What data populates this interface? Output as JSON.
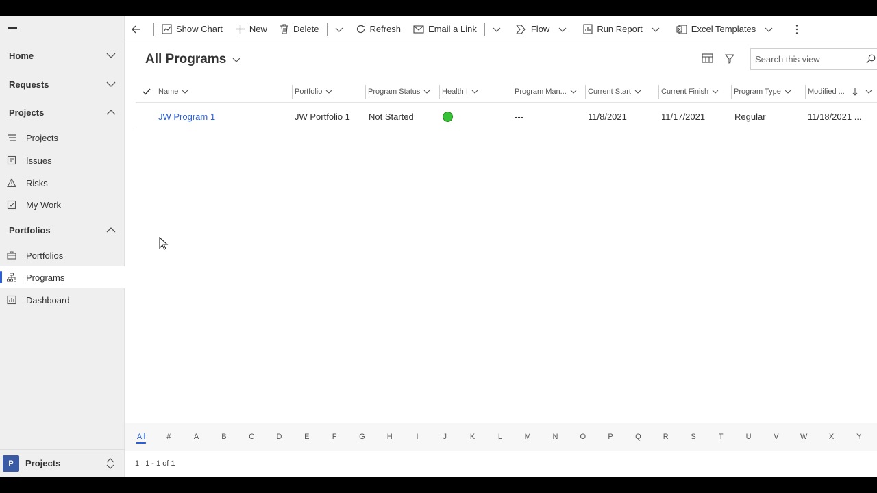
{
  "sidebar": {
    "groups": [
      {
        "label": "Home"
      },
      {
        "label": "Requests"
      },
      {
        "label": "Projects"
      },
      {
        "label": "Portfolios"
      }
    ],
    "items": [
      {
        "label": "Projects",
        "icon": "list-icon"
      },
      {
        "label": "Issues",
        "icon": "issues-icon"
      },
      {
        "label": "Risks",
        "icon": "warning-icon"
      },
      {
        "label": "My Work",
        "icon": "checkbox-icon"
      },
      {
        "label": "Portfolios",
        "icon": "briefcase-icon"
      },
      {
        "label": "Programs",
        "icon": "hierarchy-icon"
      },
      {
        "label": "Dashboard",
        "icon": "dashboard-icon"
      }
    ],
    "area": {
      "badge": "P",
      "label": "Projects"
    }
  },
  "commandbar": {
    "show_chart": "Show Chart",
    "new": "New",
    "delete": "Delete",
    "refresh": "Refresh",
    "email_link": "Email a Link",
    "flow": "Flow",
    "run_report": "Run Report",
    "excel_templates": "Excel Templates"
  },
  "view": {
    "title": "All Programs",
    "search_placeholder": "Search this view"
  },
  "grid": {
    "columns": [
      "Name",
      "Portfolio",
      "Program Status",
      "Health I",
      "Program Man...",
      "Current Start",
      "Current Finish",
      "Program Type",
      "Modified ..."
    ],
    "rows": [
      {
        "name": "JW Program 1",
        "portfolio": "JW Portfolio 1",
        "status": "Not Started",
        "health_color": "#36c236",
        "manager": "---",
        "start": "11/8/2021",
        "finish": "11/17/2021",
        "type": "Regular",
        "modified": "11/18/2021 ..."
      }
    ]
  },
  "jumpbar": [
    "All",
    "#",
    "A",
    "B",
    "C",
    "D",
    "E",
    "F",
    "G",
    "H",
    "I",
    "J",
    "K",
    "L",
    "M",
    "N",
    "O",
    "P",
    "Q",
    "R",
    "S",
    "T",
    "U",
    "V",
    "W",
    "X",
    "Y"
  ],
  "footer": {
    "page": "1",
    "range": "1 - 1 of 1"
  }
}
